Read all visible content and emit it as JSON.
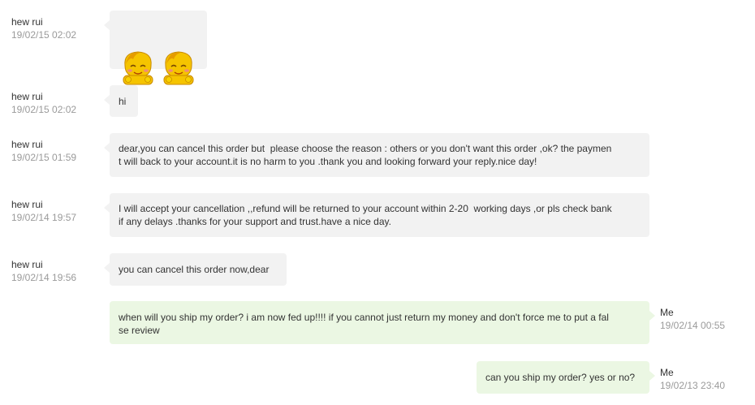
{
  "messages": [
    {
      "sender": "hew rui",
      "time": "19/02/15 02:02",
      "type": "emoji",
      "emoji": [
        "smile-emoji",
        "smile-emoji"
      ]
    },
    {
      "sender": "hew rui",
      "time": "19/02/15 02:02",
      "text": "hi"
    },
    {
      "sender": "hew rui",
      "time": "19/02/15 01:59",
      "text": "dear,you can cancel this order but  please choose the reason : others or you don't want this order ,ok? the paymen\nt will back to your account.it is no harm to you .thank you and looking forward your reply.nice day!"
    },
    {
      "sender": "hew rui",
      "time": "19/02/14 19:57",
      "text": "I will accept your cancellation ,,refund will be returned to your account within 2-20  working days ,or pls check bank\nif any delays .thanks for your support and trust.have a nice day."
    },
    {
      "sender": "hew rui",
      "time": "19/02/14 19:56",
      "text": "you can cancel this order now,dear"
    },
    {
      "sender": "Me",
      "time": "19/02/14 00:55",
      "text": "when will you ship my order? i am now fed up!!!! if you cannot just return my money and don't force me to put a fal\nse review"
    },
    {
      "sender": "Me",
      "time": "19/02/13 23:40",
      "text": "can you ship my order? yes or no?"
    }
  ],
  "colors": {
    "incoming_bubble": "#f2f2f2",
    "outgoing_bubble": "#ebf7e3",
    "timestamp": "#9a9a9a",
    "text": "#333333"
  }
}
